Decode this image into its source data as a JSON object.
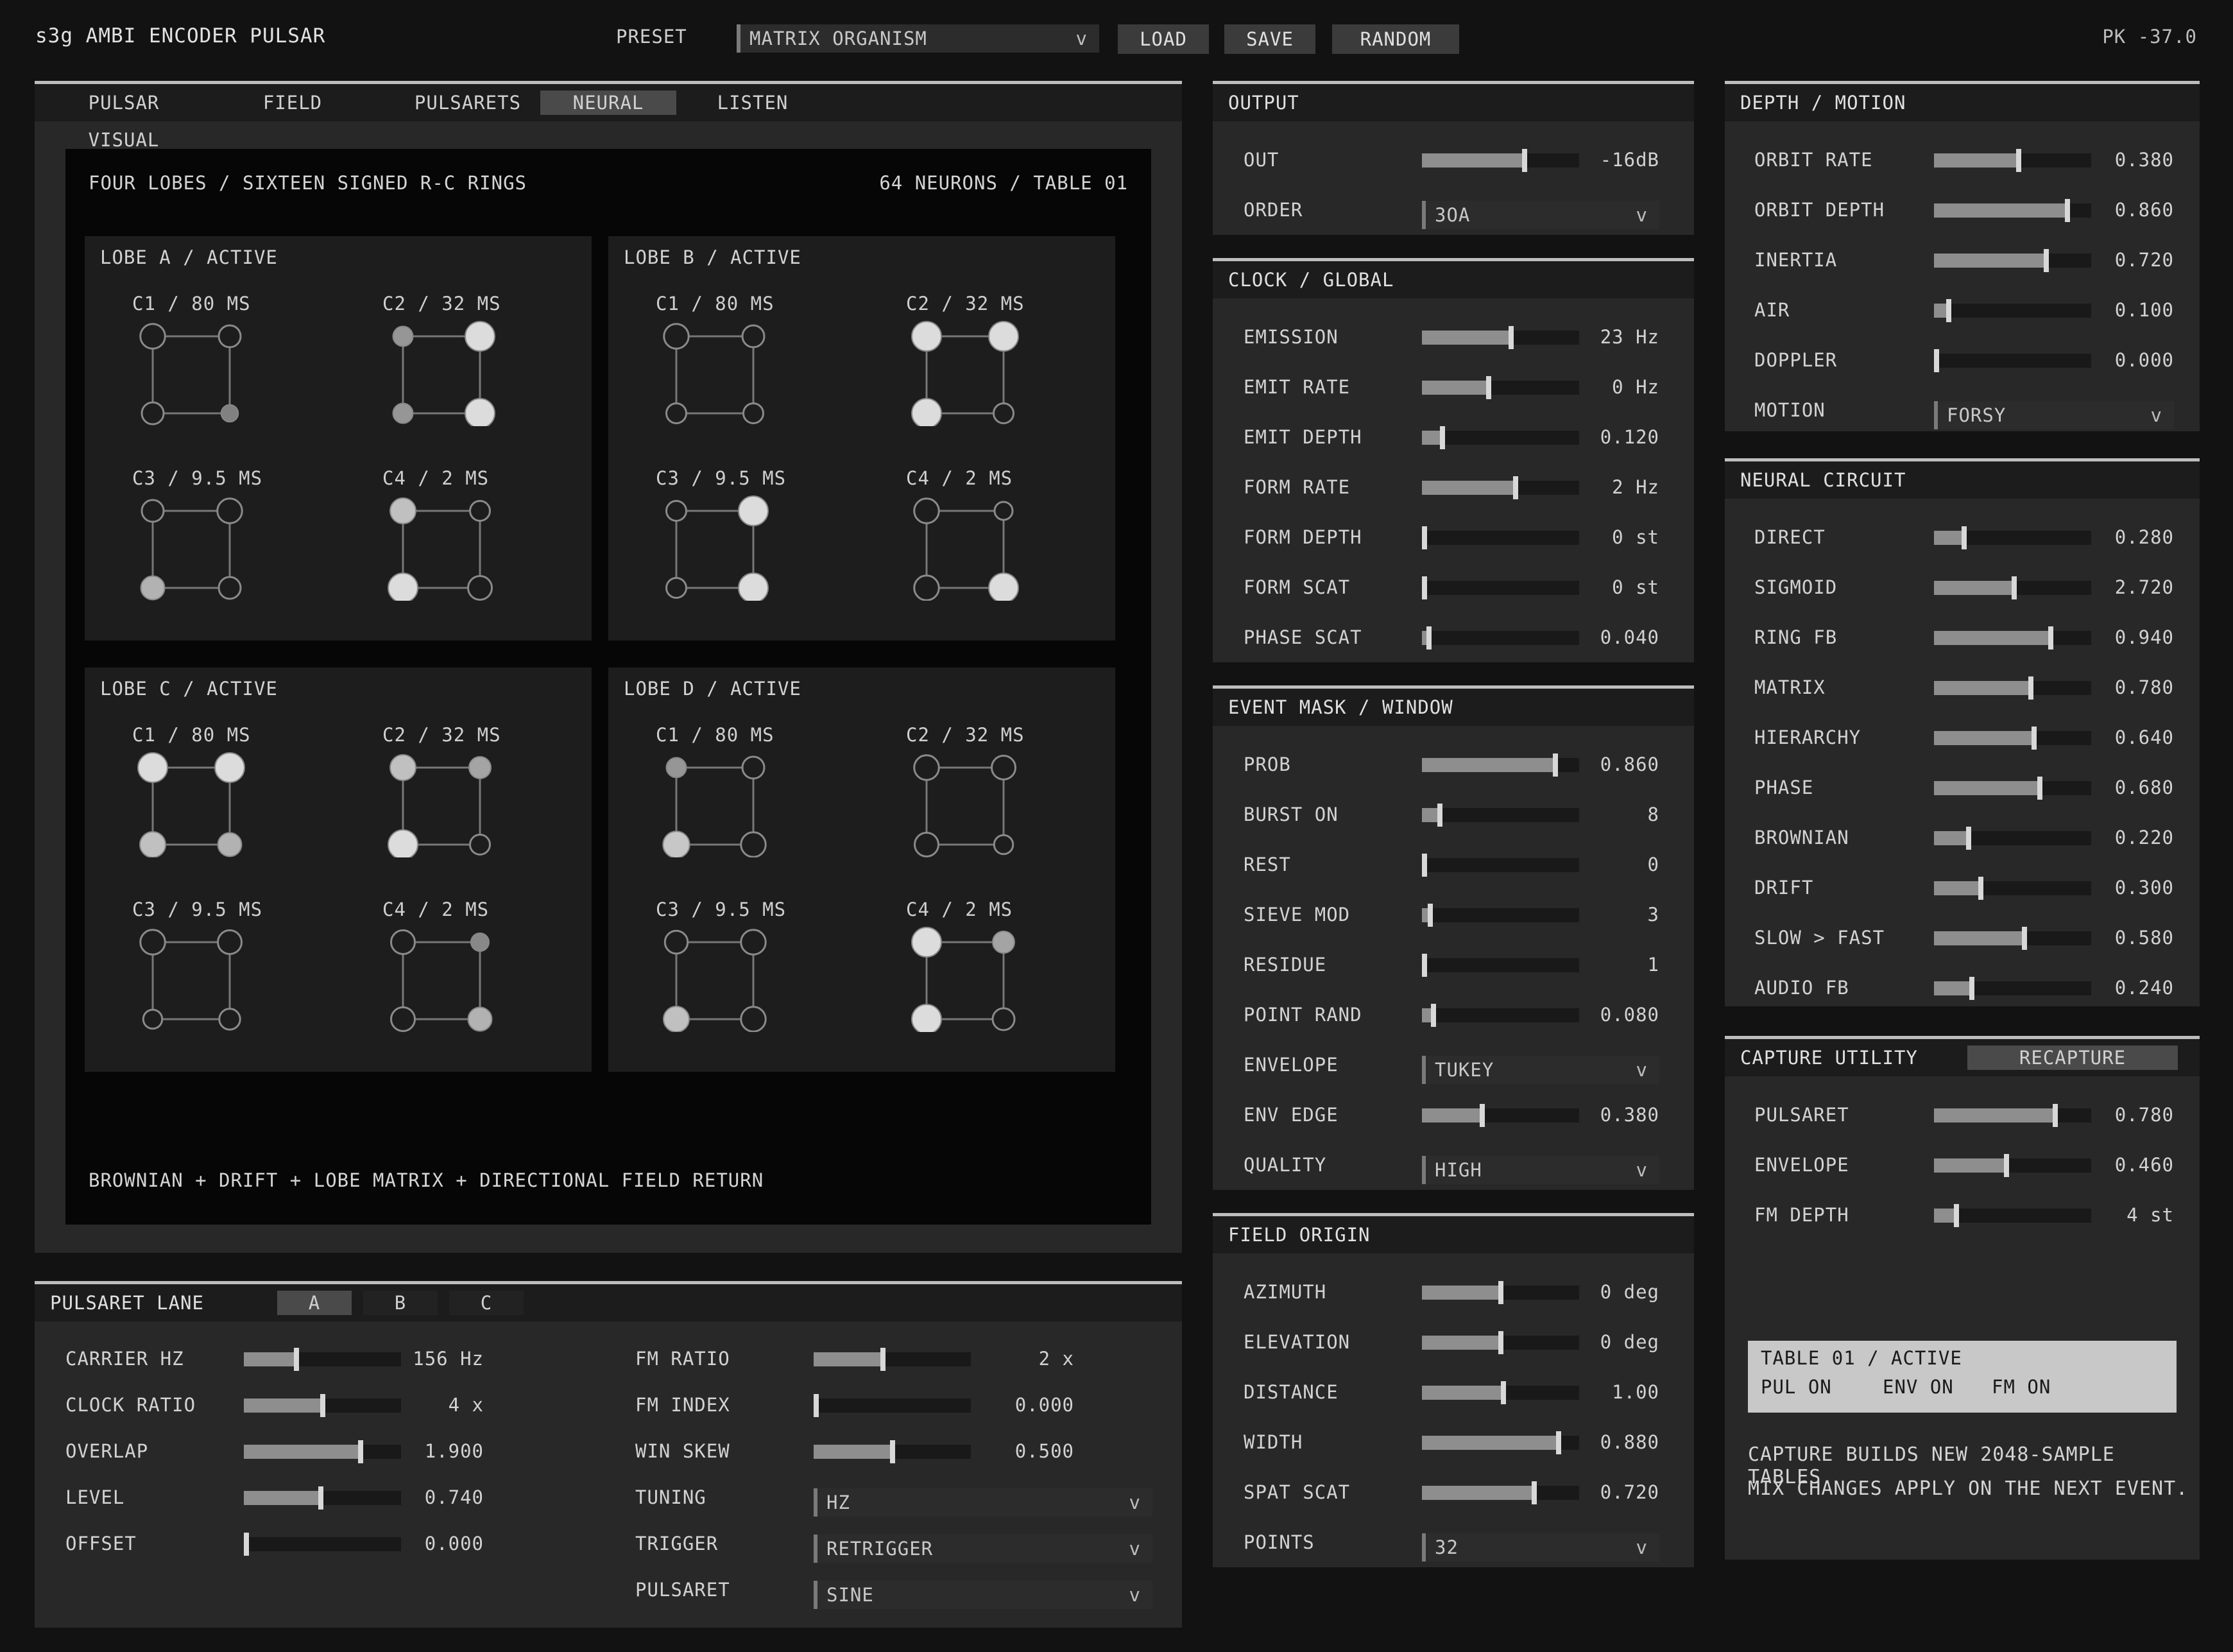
{
  "header": {
    "title": "s3g AMBI ENCODER PULSAR",
    "preset_label": "PRESET",
    "preset_value": "MATRIX ORGANISM",
    "load": "LOAD",
    "save": "SAVE",
    "random": "RANDOM",
    "peak": "PK -37.0"
  },
  "main": {
    "tabs": [
      "PULSAR VISUAL",
      "FIELD",
      "PULSARETS",
      "NEURAL",
      "LISTEN"
    ],
    "active_tab": "NEURAL",
    "vis_title": "FOUR LOBES / SIXTEEN SIGNED R-C RINGS",
    "vis_meta": "64 NEURONS / TABLE 01",
    "vis_footer": "BROWNIAN + DRIFT + LOBE MATRIX + DIRECTIONAL FIELD RETURN",
    "lobes": [
      {
        "title": "LOBE A / ACTIVE",
        "cells": [
          {
            "title": "C1 / 80 MS",
            "nodes": [
              [
                1,
                "r",
                0.75
              ],
              [
                1,
                "r",
                0.6
              ],
              [
                1,
                "r",
                0.6
              ],
              [
                0,
                "f",
                0.35
              ]
            ]
          },
          {
            "title": "C2 / 32 MS",
            "nodes": [
              [
                0,
                "f",
                0.5
              ],
              [
                1,
                "f",
                1.0
              ],
              [
                0,
                "f",
                0.5
              ],
              [
                1,
                "f",
                1.0
              ]
            ]
          },
          {
            "title": "C3 / 9.5 MS",
            "nodes": [
              [
                1,
                "r",
                0.6
              ],
              [
                1,
                "r",
                0.75
              ],
              [
                0,
                "f",
                0.7
              ],
              [
                1,
                "r",
                0.6
              ]
            ]
          },
          {
            "title": "C4 / 2 MS",
            "nodes": [
              [
                1,
                "f",
                0.8
              ],
              [
                1,
                "r",
                0.5
              ],
              [
                1,
                "f",
                1.0
              ],
              [
                1,
                "r",
                0.7
              ]
            ]
          }
        ]
      },
      {
        "title": "LOBE B / ACTIVE",
        "cells": [
          {
            "title": "C1 / 80 MS",
            "nodes": [
              [
                1,
                "r",
                0.75
              ],
              [
                1,
                "r",
                0.6
              ],
              [
                0,
                "r",
                0.5
              ],
              [
                1,
                "r",
                0.5
              ]
            ]
          },
          {
            "title": "C2 / 32 MS",
            "nodes": [
              [
                1,
                "f",
                1.0
              ],
              [
                1,
                "f",
                1.0
              ],
              [
                1,
                "f",
                1.0
              ],
              [
                0,
                "r",
                0.5
              ]
            ]
          },
          {
            "title": "C3 / 9.5 MS",
            "nodes": [
              [
                0,
                "r",
                0.5
              ],
              [
                1,
                "f",
                1.0
              ],
              [
                1,
                "r",
                0.5
              ],
              [
                1,
                "f",
                1.0
              ]
            ]
          },
          {
            "title": "C4 / 2 MS",
            "nodes": [
              [
                1,
                "r",
                0.75
              ],
              [
                0,
                "r",
                0.4
              ],
              [
                1,
                "r",
                0.75
              ],
              [
                1,
                "f",
                1.0
              ]
            ]
          }
        ]
      },
      {
        "title": "LOBE C / ACTIVE",
        "cells": [
          {
            "title": "C1 / 80 MS",
            "nodes": [
              [
                1,
                "f",
                1.0
              ],
              [
                1,
                "f",
                1.0
              ],
              [
                1,
                "f",
                0.8
              ],
              [
                1,
                "f",
                0.7
              ]
            ]
          },
          {
            "title": "C2 / 32 MS",
            "nodes": [
              [
                1,
                "f",
                0.8
              ],
              [
                1,
                "f",
                0.6
              ],
              [
                1,
                "f",
                1.0
              ],
              [
                1,
                "r",
                0.5
              ]
            ]
          },
          {
            "title": "C3 / 9.5 MS",
            "nodes": [
              [
                1,
                "r",
                0.75
              ],
              [
                1,
                "r",
                0.7
              ],
              [
                0,
                "r",
                0.45
              ],
              [
                1,
                "r",
                0.55
              ]
            ]
          },
          {
            "title": "C4 / 2 MS",
            "nodes": [
              [
                1,
                "r",
                0.7
              ],
              [
                1,
                "f",
                0.4
              ],
              [
                1,
                "r",
                0.7
              ],
              [
                1,
                "f",
                0.7
              ]
            ]
          }
        ]
      },
      {
        "title": "LOBE D / ACTIVE",
        "cells": [
          {
            "title": "C1 / 80 MS",
            "nodes": [
              [
                1,
                "f",
                0.5
              ],
              [
                1,
                "r",
                0.6
              ],
              [
                1,
                "f",
                0.85
              ],
              [
                1,
                "r",
                0.75
              ]
            ]
          },
          {
            "title": "C2 / 32 MS",
            "nodes": [
              [
                1,
                "r",
                0.75
              ],
              [
                1,
                "r",
                0.7
              ],
              [
                1,
                "r",
                0.7
              ],
              [
                0,
                "r",
                0.45
              ]
            ]
          },
          {
            "title": "C3 / 9.5 MS",
            "nodes": [
              [
                1,
                "r",
                0.65
              ],
              [
                1,
                "r",
                0.75
              ],
              [
                1,
                "f",
                0.8
              ],
              [
                1,
                "r",
                0.75
              ]
            ]
          },
          {
            "title": "C4 / 2 MS",
            "nodes": [
              [
                1,
                "f",
                1.0
              ],
              [
                1,
                "f",
                0.6
              ],
              [
                1,
                "f",
                1.0
              ],
              [
                1,
                "r",
                0.6
              ]
            ]
          }
        ]
      }
    ]
  },
  "pulsaret_lane": {
    "title": "PULSARET LANE",
    "tabs": [
      "A",
      "B",
      "C"
    ],
    "active_tab": "A",
    "left": [
      {
        "label": "CARRIER HZ",
        "value": "156 Hz",
        "level": 0.33
      },
      {
        "label": "CLOCK RATIO",
        "value": "4 x",
        "level": 0.5
      },
      {
        "label": "OVERLAP",
        "value": "1.900",
        "level": 0.75
      },
      {
        "label": "LEVEL",
        "value": "0.740",
        "level": 0.49
      },
      {
        "label": "OFFSET",
        "value": "0.000",
        "level": 0.0
      }
    ],
    "right_sliders": [
      {
        "label": "FM RATIO",
        "value": "2 x",
        "level": 0.44
      },
      {
        "label": "FM INDEX",
        "value": "0.000",
        "level": 0.0
      },
      {
        "label": "WIN SKEW",
        "value": "0.500",
        "level": 0.5
      }
    ],
    "right_selects": [
      {
        "label": "TUNING",
        "value": "HZ"
      },
      {
        "label": "TRIGGER",
        "value": "RETRIGGER"
      },
      {
        "label": "PULSARET",
        "value": "SINE"
      }
    ]
  },
  "output": {
    "title": "OUTPUT",
    "out": {
      "label": "OUT",
      "value": "-16dB",
      "level": 0.66
    },
    "order": {
      "label": "ORDER",
      "value": "3OA"
    }
  },
  "clock": {
    "title": "CLOCK / GLOBAL",
    "rows": [
      {
        "label": "EMISSION",
        "value": "23 Hz",
        "level": 0.57
      },
      {
        "label": "EMIT RATE",
        "value": "0 Hz",
        "level": 0.42
      },
      {
        "label": "EMIT DEPTH",
        "value": "0.120",
        "level": 0.12
      },
      {
        "label": "FORM RATE",
        "value": "2 Hz",
        "level": 0.6
      },
      {
        "label": "FORM DEPTH",
        "value": "0 st",
        "level": 0.0
      },
      {
        "label": "FORM SCAT",
        "value": "0 st",
        "level": 0.0
      },
      {
        "label": "PHASE SCAT",
        "value": "0.040",
        "level": 0.03
      }
    ]
  },
  "event": {
    "title": "EVENT MASK / WINDOW",
    "sliders": [
      {
        "label": "PROB",
        "value": "0.860",
        "level": 0.86
      },
      {
        "label": "BURST ON",
        "value": "8",
        "level": 0.1
      },
      {
        "label": "REST",
        "value": "0",
        "level": 0.0
      },
      {
        "label": "SIEVE MOD",
        "value": "3",
        "level": 0.04
      },
      {
        "label": "RESIDUE",
        "value": "1",
        "level": 0.0
      },
      {
        "label": "POINT RAND",
        "value": "0.080",
        "level": 0.06
      }
    ],
    "envelope": {
      "label": "ENVELOPE",
      "value": "TUKEY"
    },
    "env_edge": {
      "label": "ENV EDGE",
      "value": "0.380",
      "level": 0.38
    },
    "quality": {
      "label": "QUALITY",
      "value": "HIGH"
    }
  },
  "field": {
    "title": "FIELD ORIGIN",
    "rows": [
      {
        "label": "AZIMUTH",
        "value": "0 deg",
        "level": 0.5
      },
      {
        "label": "ELEVATION",
        "value": "0 deg",
        "level": 0.5
      },
      {
        "label": "DISTANCE",
        "value": "1.00",
        "level": 0.52
      },
      {
        "label": "WIDTH",
        "value": "0.880",
        "level": 0.88
      },
      {
        "label": "SPAT SCAT",
        "value": "0.720",
        "level": 0.72
      }
    ],
    "points": {
      "label": "POINTS",
      "value": "32"
    }
  },
  "depth": {
    "title": "DEPTH / MOTION",
    "rows": [
      {
        "label": "ORBIT RATE",
        "value": "0.380",
        "level": 0.54
      },
      {
        "label": "ORBIT DEPTH",
        "value": "0.860",
        "level": 0.86
      },
      {
        "label": "INERTIA",
        "value": "0.720",
        "level": 0.72
      },
      {
        "label": "AIR",
        "value": "0.100",
        "level": 0.08
      },
      {
        "label": "DOPPLER",
        "value": "0.000",
        "level": 0.0
      }
    ],
    "motion": {
      "label": "MOTION",
      "value": "FORSY"
    }
  },
  "neural": {
    "title": "NEURAL CIRCUIT",
    "rows": [
      {
        "label": "DIRECT",
        "value": "0.280",
        "level": 0.18
      },
      {
        "label": "SIGMOID",
        "value": "2.720",
        "level": 0.51
      },
      {
        "label": "RING FB",
        "value": "0.940",
        "level": 0.75
      },
      {
        "label": "MATRIX",
        "value": "0.780",
        "level": 0.62
      },
      {
        "label": "HIERARCHY",
        "value": "0.640",
        "level": 0.64
      },
      {
        "label": "PHASE",
        "value": "0.680",
        "level": 0.68
      },
      {
        "label": "BROWNIAN",
        "value": "0.220",
        "level": 0.21
      },
      {
        "label": "DRIFT",
        "value": "0.300",
        "level": 0.29
      },
      {
        "label": "SLOW > FAST",
        "value": "0.580",
        "level": 0.58
      },
      {
        "label": "AUDIO FB",
        "value": "0.240",
        "level": 0.23
      }
    ]
  },
  "capture": {
    "title": "CAPTURE UTILITY",
    "recapture": "RECAPTURE",
    "rows": [
      {
        "label": "PULSARET",
        "value": "0.780",
        "level": 0.78
      },
      {
        "label": "ENVELOPE",
        "value": "0.460",
        "level": 0.46
      },
      {
        "label": "FM DEPTH",
        "value": "4 st",
        "level": 0.13
      }
    ],
    "table_status": "TABLE 01 / ACTIVE",
    "pul": "PUL ON",
    "env": "ENV ON",
    "fm": "FM ON",
    "note1": "CAPTURE BUILDS NEW 2048-SAMPLE TABLES.",
    "note2": "MIX CHANGES APPLY ON THE NEXT EVENT."
  }
}
